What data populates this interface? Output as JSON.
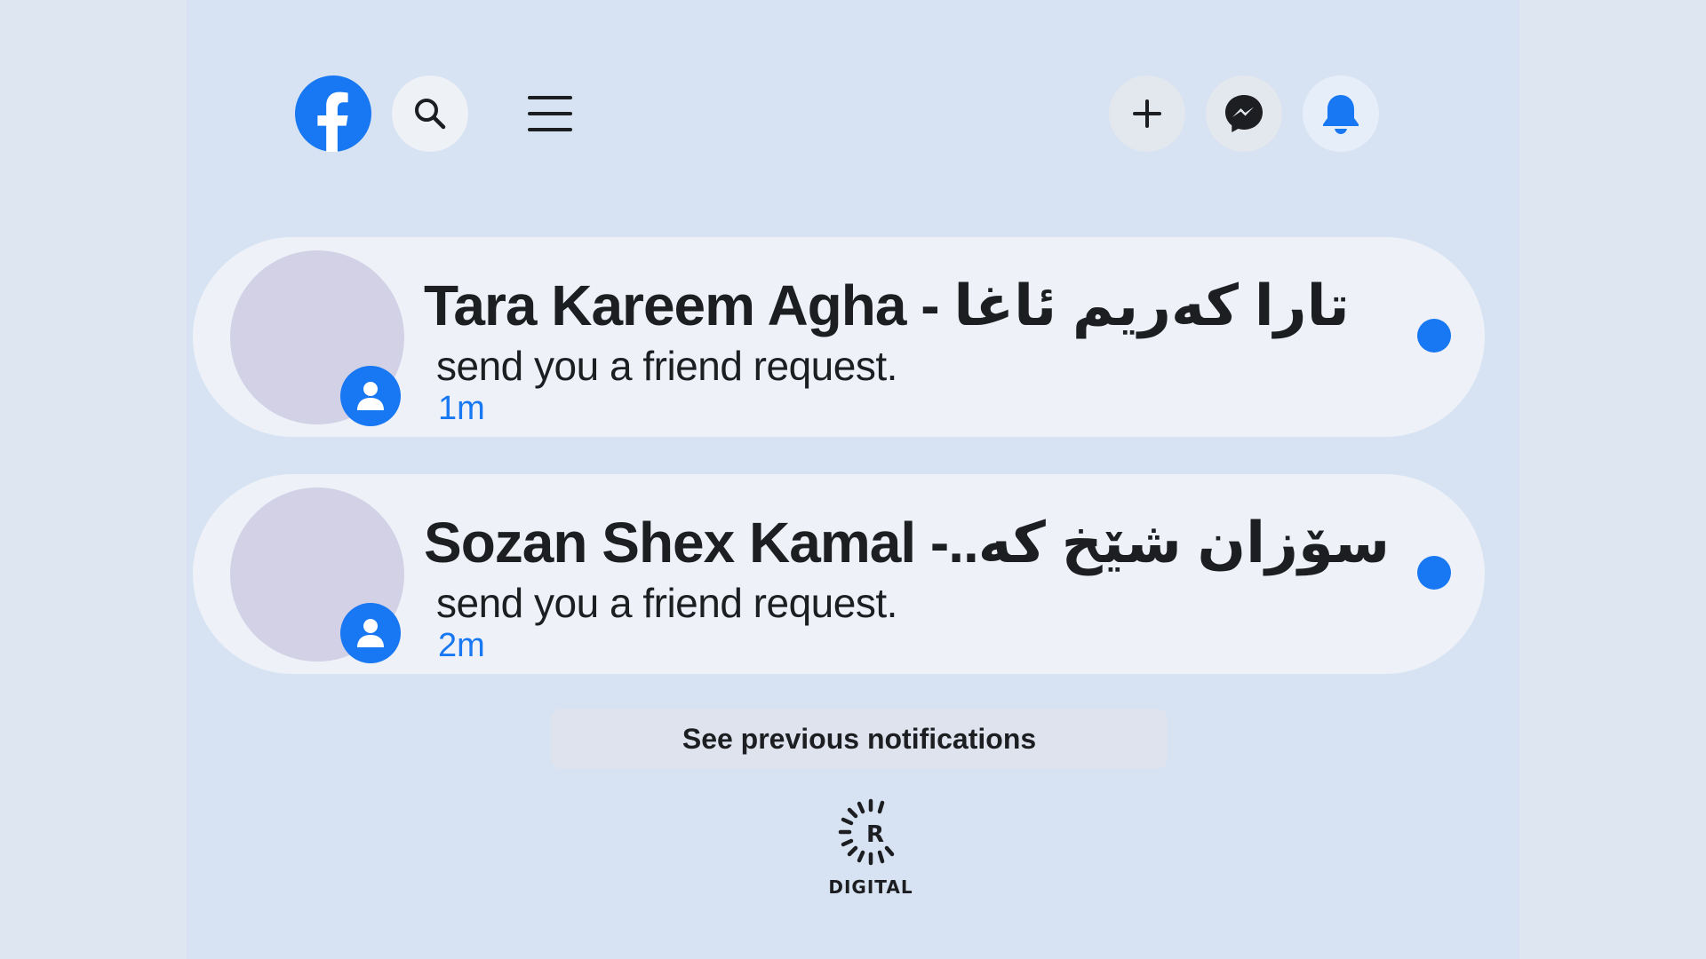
{
  "header": {
    "logo_icon": "facebook-icon",
    "search_icon": "search-icon",
    "menu_icon": "hamburger-menu-icon",
    "create_icon": "plus-icon",
    "messenger_icon": "messenger-icon",
    "notifications_icon": "bell-icon"
  },
  "colors": {
    "brand_blue": "#1877f2",
    "page_bg": "#d7e3f2",
    "card_bg": "#eef2f8",
    "text_dark": "#1c1e21"
  },
  "notifications": [
    {
      "name": "Tara Kareem Agha - تارا کەریم ئاغا",
      "message": "send you a friend request.",
      "time": "1m",
      "unread": true,
      "badge_icon": "person-icon"
    },
    {
      "name": "Sozan Shex Kamal -..سۆزان شێخ کە",
      "message": "send you a friend request.",
      "time": "2m",
      "unread": true,
      "badge_icon": "person-icon"
    }
  ],
  "footer": {
    "see_previous_label": "See previous notifications",
    "brand_letter": "R",
    "brand_text": "DIGITAL"
  }
}
